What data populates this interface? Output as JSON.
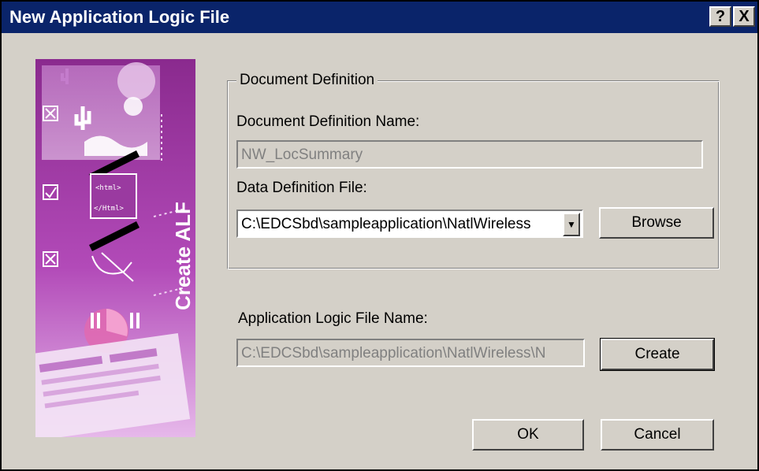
{
  "window": {
    "title": "New Application Logic File",
    "help_label": "?",
    "close_label": "X"
  },
  "banner": {
    "label": "Create ALF",
    "html_open": "<html>",
    "html_close": "</Html>",
    "colors": {
      "top": "#8a2a8e",
      "bottom": "#e6b8ea"
    }
  },
  "document_definition": {
    "group_label": "Document Definition",
    "name_label": "Document Definition Name:",
    "name_value": "NW_LocSummary",
    "data_file_label": "Data Definition File:",
    "data_file_value": "C:\\EDCSbd\\sampleapplication\\NatlWireless",
    "dropdown_icon": "chevron-down-icon",
    "browse_label": "Browse"
  },
  "alf": {
    "name_label": "Application Logic File Name:",
    "name_value": "C:\\EDCSbd\\sampleapplication\\NatlWireless\\N",
    "create_label": "Create"
  },
  "footer": {
    "ok_label": "OK",
    "cancel_label": "Cancel"
  }
}
